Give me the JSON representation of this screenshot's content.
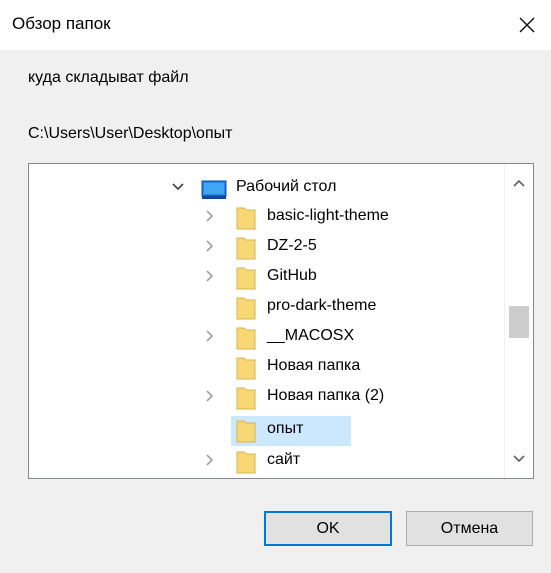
{
  "window": {
    "title": "Обзор папок"
  },
  "prompt": "куда складыват файл",
  "selected_path": "C:\\Users\\User\\Desktop\\опыт",
  "tree": {
    "root": {
      "label": "Рабочий стол",
      "expanded": true
    },
    "items": [
      {
        "label": "basic-light-theme",
        "has_children": true
      },
      {
        "label": "DZ-2-5",
        "has_children": true
      },
      {
        "label": "GitHub",
        "has_children": true
      },
      {
        "label": "pro-dark-theme",
        "has_children": false
      },
      {
        "label": "__MACOSX",
        "has_children": true
      },
      {
        "label": "Новая папка",
        "has_children": false
      },
      {
        "label": "Новая папка (2)",
        "has_children": true
      },
      {
        "label": "опыт",
        "has_children": false,
        "selected": true
      },
      {
        "label": "сайт",
        "has_children": true
      }
    ]
  },
  "buttons": {
    "ok": "OK",
    "cancel": "Отмена"
  },
  "colors": {
    "accent": "#0078d7",
    "selection": "#cce8ff",
    "folder": "#f8d775"
  }
}
